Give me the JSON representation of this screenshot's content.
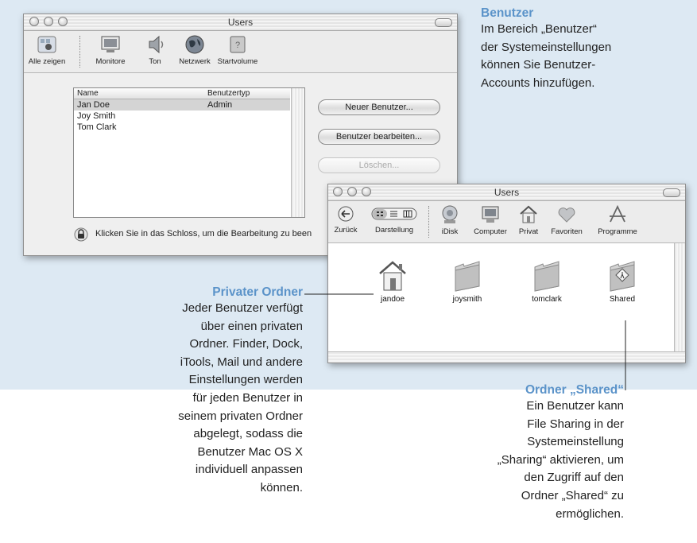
{
  "window1": {
    "title": "Users",
    "toolbar": [
      "Alle zeigen",
      "Monitore",
      "Ton",
      "Netzwerk",
      "Startvolume"
    ],
    "columns": [
      "Name",
      "Benutzertyp"
    ],
    "rows": [
      {
        "name": "Jan Doe",
        "type": "Admin"
      },
      {
        "name": "Joy Smith",
        "type": ""
      },
      {
        "name": "Tom Clark",
        "type": ""
      }
    ],
    "buttons": {
      "new": "Neuer Benutzer...",
      "edit": "Benutzer bearbeiten...",
      "delete": "Löschen..."
    },
    "lock_text": "Klicken Sie in das Schloss, um die Bearbeitung zu been"
  },
  "window2": {
    "title": "Users",
    "toolbar": [
      "Zurück",
      "Darstellung",
      "iDisk",
      "Computer",
      "Privat",
      "Favoriten",
      "Programme"
    ],
    "items": [
      "jandoe",
      "joysmith",
      "tomclark",
      "Shared"
    ]
  },
  "callouts": {
    "benutzer": {
      "title": "Benutzer",
      "lines": [
        "Im Bereich „Benutzer“",
        "der Systemeinstellungen",
        "können Sie Benutzer-",
        "Accounts hinzufügen."
      ]
    },
    "privat": {
      "title": "Privater Ordner",
      "lines": [
        "Jeder Benutzer verfügt",
        "über einen privaten",
        "Ordner. Finder, Dock,",
        "iTools, Mail und andere",
        "Einstellungen werden",
        "für jeden Benutzer in",
        "seinem privaten Ordner",
        "abgelegt, sodass die",
        "Benutzer Mac OS X",
        "individuell anpassen",
        "können."
      ]
    },
    "shared": {
      "title": "Ordner „Shared“",
      "lines": [
        "Ein Benutzer kann",
        "File Sharing in der",
        "Systemeinstellung",
        "„Sharing“ aktivieren, um",
        "den Zugriff auf den",
        "Ordner „Shared“ zu",
        "ermöglichen."
      ]
    }
  },
  "colors": {
    "callout_title": "#5b93c9",
    "background_band": "#dde9f3"
  }
}
